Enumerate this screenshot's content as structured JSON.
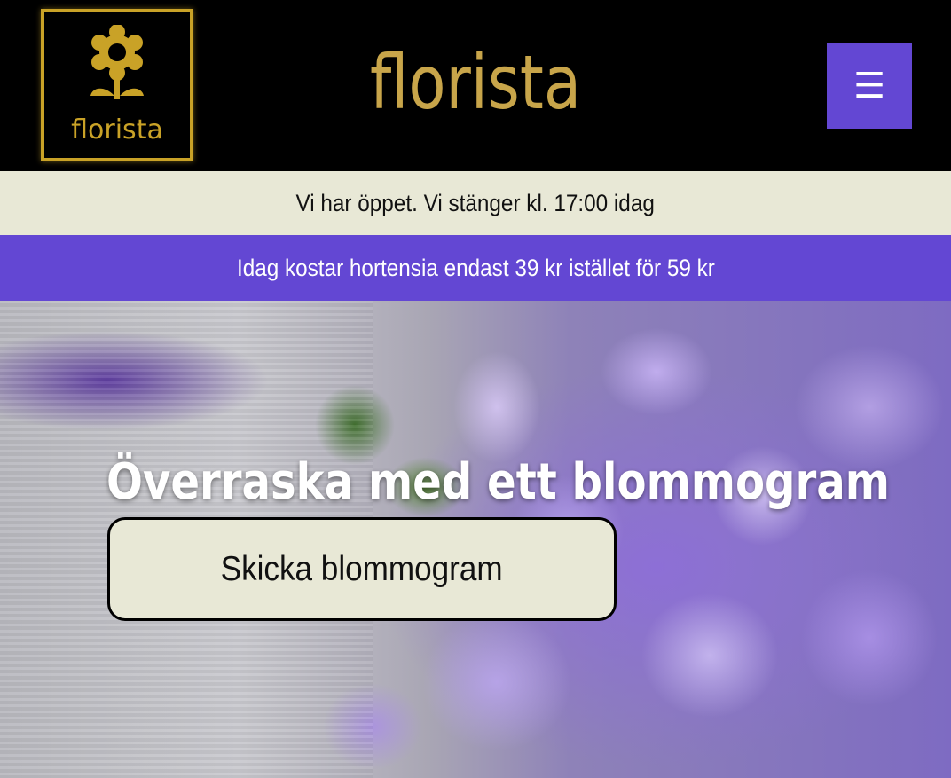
{
  "header": {
    "logo_text": "florista",
    "site_title": "florista",
    "menu_icon": "menu-icon"
  },
  "status_bar": {
    "text": "Vi har öppet. Vi stänger kl. 17:00 idag"
  },
  "promo_bar": {
    "text": "Idag kostar hortensia endast 39 kr istället för 59 kr"
  },
  "hero": {
    "title": "Överraska med ett blommogram",
    "cta_label": "Skicka blommogram"
  },
  "colors": {
    "header_bg": "#000000",
    "gold": "#c8a54a",
    "accent_purple": "#6347d3",
    "cream": "#e8e8d6"
  }
}
